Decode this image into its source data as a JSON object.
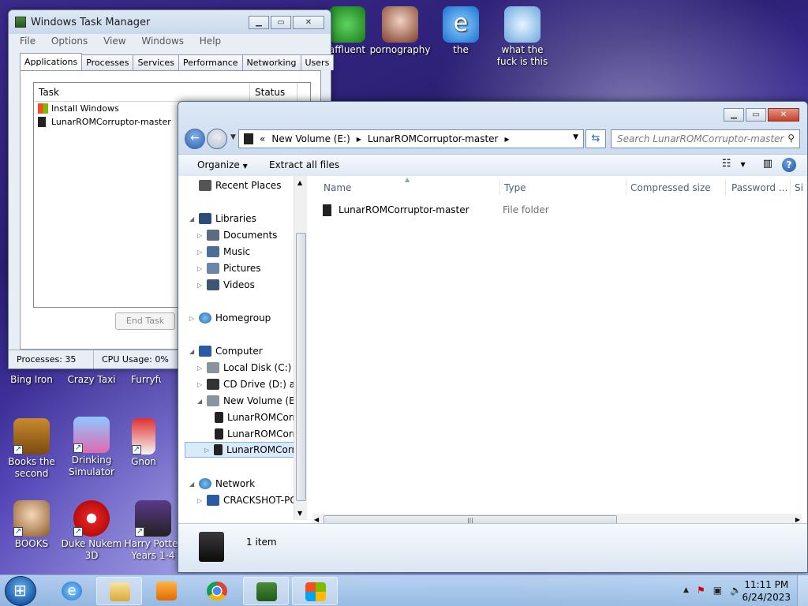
{
  "desktop": {
    "top_icons": [
      {
        "label": "affluent",
        "icon": "green-character-icon"
      },
      {
        "label": "pornography",
        "icon": "anime-girl-icon"
      },
      {
        "label": "the",
        "icon": "internet-explorer-icon"
      },
      {
        "label": "what the fuck is this",
        "icon": "diamond-icon"
      }
    ],
    "left_icons": [
      {
        "label": "Bing Iron",
        "icon": "bing-icon"
      },
      {
        "label": "Crazy Taxi",
        "icon": "taxi-icon"
      },
      {
        "label": "Furryfu",
        "icon": "furry-icon"
      },
      {
        "label": "Books the second",
        "icon": "book-icon"
      },
      {
        "label": "Drinking Simulator",
        "icon": "cocktail-icon"
      },
      {
        "label": "Gnon",
        "icon": "gnome-icon"
      },
      {
        "label": "BOOKS",
        "icon": "girl-icon"
      },
      {
        "label": "Duke Nukem 3D",
        "icon": "radiation-icon"
      },
      {
        "label": "Harry Potter Years 1-4",
        "icon": "wizard-icon"
      }
    ]
  },
  "task_manager": {
    "title": "Windows Task Manager",
    "menu": [
      "File",
      "Options",
      "View",
      "Windows",
      "Help"
    ],
    "tabs": [
      "Applications",
      "Processes",
      "Services",
      "Performance",
      "Networking",
      "Users"
    ],
    "columns": [
      "Task",
      "Status"
    ],
    "tasks": [
      "Install Windows",
      "LunarROMCorruptor-master"
    ],
    "end_task": "End Task",
    "status": {
      "processes": "Processes: 35",
      "cpu": "CPU Usage: 0%"
    }
  },
  "explorer": {
    "address": {
      "prefix": "«",
      "crumbs": [
        "New Volume (E:)",
        "LunarROMCorruptor-master"
      ]
    },
    "search_placeholder": "Search LunarROMCorruptor-master",
    "toolbar": {
      "organize": "Organize",
      "extract": "Extract all files"
    },
    "nav": {
      "recent_places": "Recent Places",
      "libraries": "Libraries",
      "documents": "Documents",
      "music": "Music",
      "pictures": "Pictures",
      "videos": "Videos",
      "homegroup": "Homegroup",
      "computer": "Computer",
      "local_disk": "Local Disk (C:)",
      "cd_drive": "CD Drive (D:) ace",
      "new_volume": "New Volume (E:)",
      "lunar1": "LunarROMCorr",
      "lunar2": "LunarROMCorr",
      "lunar3": "LunarROMCorr",
      "network": "Network",
      "crackshot": "CRACKSHOT-PC"
    },
    "columns": [
      "Name",
      "Type",
      "Compressed size",
      "Password ...",
      "Si"
    ],
    "files": [
      {
        "name": "LunarROMCorruptor-master",
        "type": "File folder"
      }
    ],
    "item_count": "1 item"
  },
  "taskbar": {
    "time": "11:11 PM",
    "date": "6/24/2023",
    "tray_chevron": "▲"
  },
  "colors": {
    "accent": "#2c62b5",
    "selection": "#d9ebfb"
  }
}
